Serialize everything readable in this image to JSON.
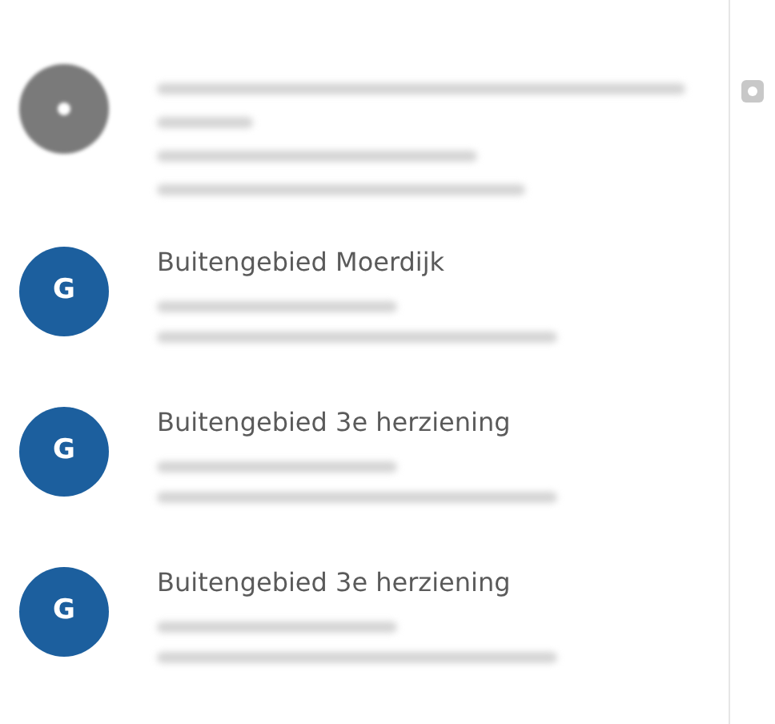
{
  "results": [
    {
      "kind": "redacted"
    },
    {
      "kind": "plan",
      "avatar": "G",
      "title": "Buitengebied Moerdijk"
    },
    {
      "kind": "plan",
      "avatar": "G",
      "title": "Buitengebied 3e herziening"
    },
    {
      "kind": "plan",
      "avatar": "G",
      "title": "Buitengebied 3e herziening"
    }
  ]
}
